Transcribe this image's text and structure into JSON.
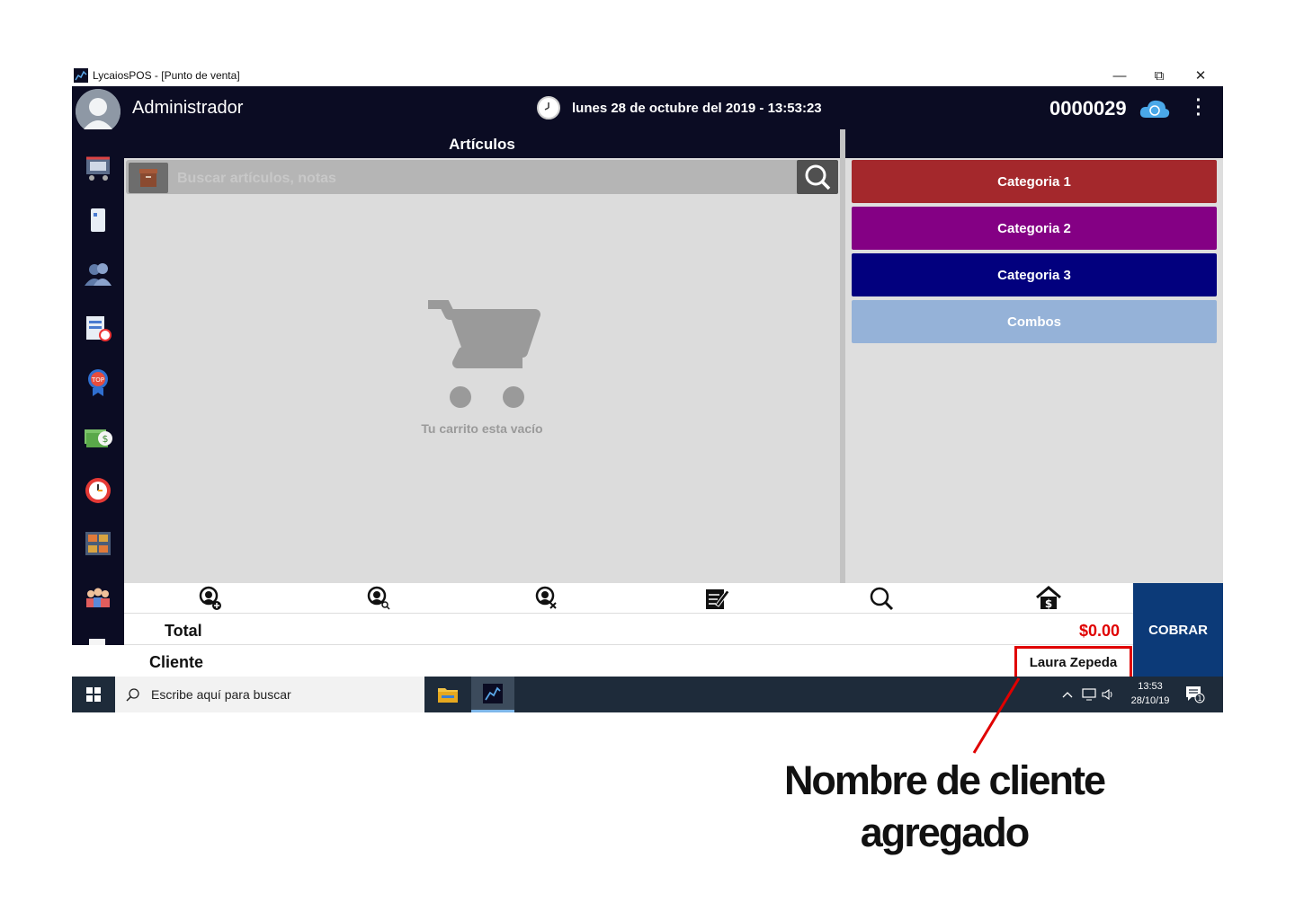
{
  "window": {
    "title": "LycaiosPOS - [Punto de venta]",
    "minimize": "—",
    "maximize": "⧉",
    "close": "✕"
  },
  "header": {
    "user": "Administrador",
    "datetime": "lunes 28 de octubre del 2019 - 13:53:23",
    "ticket_number": "0000029"
  },
  "articles": {
    "title": "Artículos",
    "search_placeholder": "Buscar artículos, notas",
    "empty_message": "Tu carrito esta vacío"
  },
  "categories": [
    {
      "label": "Categoria 1",
      "color": "#a4282c"
    },
    {
      "label": "Categoria 2",
      "color": "#840084"
    },
    {
      "label": "Categoria 3",
      "color": "#02007e"
    },
    {
      "label": "Combos",
      "color": "#95b2d8"
    }
  ],
  "toolbar": {
    "icons": [
      "add-client-icon",
      "search-client-icon",
      "remove-client-icon",
      "notes-icon",
      "search-icon",
      "home-price-icon"
    ]
  },
  "totals": {
    "total_label": "Total",
    "total_value": "$0.00",
    "client_label": "Cliente",
    "client_name": "Laura Zepeda",
    "charge_button": "COBRAR"
  },
  "taskbar": {
    "search_placeholder": "Escribe aquí para buscar",
    "time": "13:53",
    "date": "28/10/19",
    "notifications": "1"
  },
  "annotation": {
    "line1": "Nombre de cliente",
    "line2": "agregado"
  },
  "colors": {
    "dark_navy": "#0b0c23",
    "cobrar_blue": "#0c3a78",
    "total_red": "#e00000"
  }
}
